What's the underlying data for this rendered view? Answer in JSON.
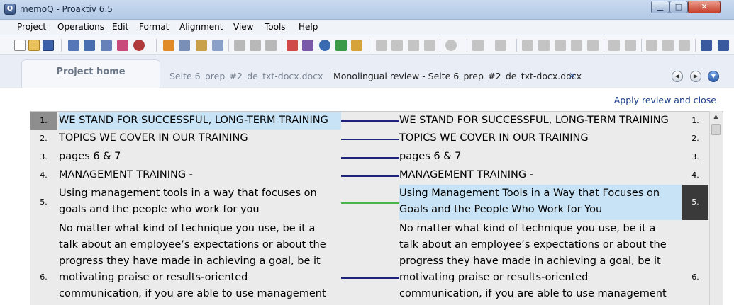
{
  "window": {
    "title": "memoQ - Proaktiv 6.5",
    "app_icon_glyph": "Q",
    "min_glyph": "▁",
    "max_glyph": "□",
    "close_glyph": "✕"
  },
  "menu": [
    "Project",
    "Operations",
    "Edit",
    "Format",
    "Alignment",
    "View",
    "Tools",
    "Help"
  ],
  "tabs": {
    "home": "Project home",
    "doc": "Seite 6_prep_#2_de_txt-docx.docx",
    "review": "Monolingual review - Seite 6_prep_#2_de_txt-docx.docx",
    "close_glyph": "✕"
  },
  "nav": {
    "prev": "◀",
    "next": "▶",
    "menu": "▼"
  },
  "apply_link": "Apply review and close",
  "segments": [
    {
      "n": "1.",
      "source": [
        "WE STAND FOR SUCCESSFUL, LONG-TERM TRAINING"
      ],
      "target": [
        "WE STAND FOR SUCCESSFUL, LONG-TERM TRAINING"
      ],
      "link": "changed-blue"
    },
    {
      "n": "2.",
      "source": [
        "TOPICS WE COVER IN OUR TRAINING"
      ],
      "target": [
        "TOPICS WE COVER IN OUR TRAINING"
      ],
      "link": "blue"
    },
    {
      "n": "3.",
      "source": [
        "pages 6 & 7"
      ],
      "target": [
        "pages 6 & 7"
      ],
      "link": "blue"
    },
    {
      "n": "4.",
      "source": [
        "MANAGEMENT TRAINING -"
      ],
      "target": [
        "MANAGEMENT TRAINING -"
      ],
      "link": "blue"
    },
    {
      "n": "5.",
      "source": [
        "Using management tools in a way that focuses on",
        "goals and the people who work for you"
      ],
      "target": [
        "Using Management Tools in a Way that Focuses on",
        "Goals and the People Who Work for You"
      ],
      "link": "green"
    },
    {
      "n": "6.",
      "source": [
        "No matter what kind of technique you use, be it a",
        "talk about an employee’s expectations or about the",
        "progress they have made in achieving a goal, be it",
        "motivating praise or results-oriented",
        "communication, if you are able to use management"
      ],
      "target": [
        "No matter what kind of technique you use, be it a",
        "talk about an employee’s expectations or about the",
        "progress they have made in achieving a goal, be it",
        "motivating praise or results-oriented",
        "communication, if you are able to use management"
      ],
      "link": "blue"
    }
  ],
  "colors": {
    "link_blue": "#1d2378",
    "link_green": "#4ab34a",
    "highlight": "#c7e3f5",
    "active_num_dark": "#3a3a3a"
  }
}
